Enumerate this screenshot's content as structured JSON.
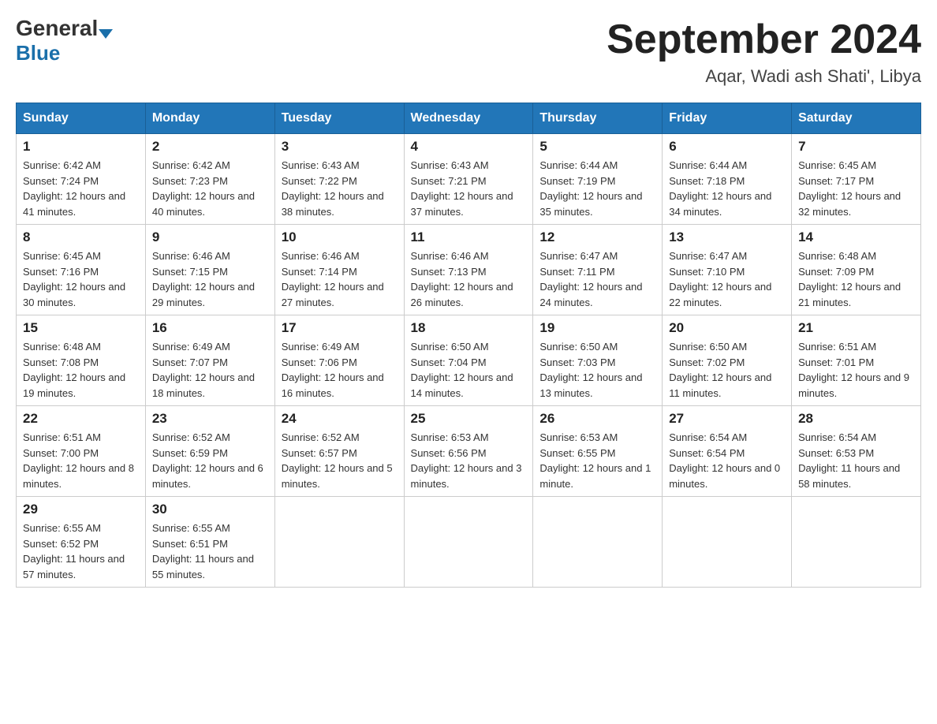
{
  "logo": {
    "general": "General",
    "blue": "Blue"
  },
  "title": {
    "month_year": "September 2024",
    "location": "Aqar, Wadi ash Shati', Libya"
  },
  "days_of_week": [
    "Sunday",
    "Monday",
    "Tuesday",
    "Wednesday",
    "Thursday",
    "Friday",
    "Saturday"
  ],
  "weeks": [
    [
      {
        "day": "1",
        "sunrise": "Sunrise: 6:42 AM",
        "sunset": "Sunset: 7:24 PM",
        "daylight": "Daylight: 12 hours and 41 minutes."
      },
      {
        "day": "2",
        "sunrise": "Sunrise: 6:42 AM",
        "sunset": "Sunset: 7:23 PM",
        "daylight": "Daylight: 12 hours and 40 minutes."
      },
      {
        "day": "3",
        "sunrise": "Sunrise: 6:43 AM",
        "sunset": "Sunset: 7:22 PM",
        "daylight": "Daylight: 12 hours and 38 minutes."
      },
      {
        "day": "4",
        "sunrise": "Sunrise: 6:43 AM",
        "sunset": "Sunset: 7:21 PM",
        "daylight": "Daylight: 12 hours and 37 minutes."
      },
      {
        "day": "5",
        "sunrise": "Sunrise: 6:44 AM",
        "sunset": "Sunset: 7:19 PM",
        "daylight": "Daylight: 12 hours and 35 minutes."
      },
      {
        "day": "6",
        "sunrise": "Sunrise: 6:44 AM",
        "sunset": "Sunset: 7:18 PM",
        "daylight": "Daylight: 12 hours and 34 minutes."
      },
      {
        "day": "7",
        "sunrise": "Sunrise: 6:45 AM",
        "sunset": "Sunset: 7:17 PM",
        "daylight": "Daylight: 12 hours and 32 minutes."
      }
    ],
    [
      {
        "day": "8",
        "sunrise": "Sunrise: 6:45 AM",
        "sunset": "Sunset: 7:16 PM",
        "daylight": "Daylight: 12 hours and 30 minutes."
      },
      {
        "day": "9",
        "sunrise": "Sunrise: 6:46 AM",
        "sunset": "Sunset: 7:15 PM",
        "daylight": "Daylight: 12 hours and 29 minutes."
      },
      {
        "day": "10",
        "sunrise": "Sunrise: 6:46 AM",
        "sunset": "Sunset: 7:14 PM",
        "daylight": "Daylight: 12 hours and 27 minutes."
      },
      {
        "day": "11",
        "sunrise": "Sunrise: 6:46 AM",
        "sunset": "Sunset: 7:13 PM",
        "daylight": "Daylight: 12 hours and 26 minutes."
      },
      {
        "day": "12",
        "sunrise": "Sunrise: 6:47 AM",
        "sunset": "Sunset: 7:11 PM",
        "daylight": "Daylight: 12 hours and 24 minutes."
      },
      {
        "day": "13",
        "sunrise": "Sunrise: 6:47 AM",
        "sunset": "Sunset: 7:10 PM",
        "daylight": "Daylight: 12 hours and 22 minutes."
      },
      {
        "day": "14",
        "sunrise": "Sunrise: 6:48 AM",
        "sunset": "Sunset: 7:09 PM",
        "daylight": "Daylight: 12 hours and 21 minutes."
      }
    ],
    [
      {
        "day": "15",
        "sunrise": "Sunrise: 6:48 AM",
        "sunset": "Sunset: 7:08 PM",
        "daylight": "Daylight: 12 hours and 19 minutes."
      },
      {
        "day": "16",
        "sunrise": "Sunrise: 6:49 AM",
        "sunset": "Sunset: 7:07 PM",
        "daylight": "Daylight: 12 hours and 18 minutes."
      },
      {
        "day": "17",
        "sunrise": "Sunrise: 6:49 AM",
        "sunset": "Sunset: 7:06 PM",
        "daylight": "Daylight: 12 hours and 16 minutes."
      },
      {
        "day": "18",
        "sunrise": "Sunrise: 6:50 AM",
        "sunset": "Sunset: 7:04 PM",
        "daylight": "Daylight: 12 hours and 14 minutes."
      },
      {
        "day": "19",
        "sunrise": "Sunrise: 6:50 AM",
        "sunset": "Sunset: 7:03 PM",
        "daylight": "Daylight: 12 hours and 13 minutes."
      },
      {
        "day": "20",
        "sunrise": "Sunrise: 6:50 AM",
        "sunset": "Sunset: 7:02 PM",
        "daylight": "Daylight: 12 hours and 11 minutes."
      },
      {
        "day": "21",
        "sunrise": "Sunrise: 6:51 AM",
        "sunset": "Sunset: 7:01 PM",
        "daylight": "Daylight: 12 hours and 9 minutes."
      }
    ],
    [
      {
        "day": "22",
        "sunrise": "Sunrise: 6:51 AM",
        "sunset": "Sunset: 7:00 PM",
        "daylight": "Daylight: 12 hours and 8 minutes."
      },
      {
        "day": "23",
        "sunrise": "Sunrise: 6:52 AM",
        "sunset": "Sunset: 6:59 PM",
        "daylight": "Daylight: 12 hours and 6 minutes."
      },
      {
        "day": "24",
        "sunrise": "Sunrise: 6:52 AM",
        "sunset": "Sunset: 6:57 PM",
        "daylight": "Daylight: 12 hours and 5 minutes."
      },
      {
        "day": "25",
        "sunrise": "Sunrise: 6:53 AM",
        "sunset": "Sunset: 6:56 PM",
        "daylight": "Daylight: 12 hours and 3 minutes."
      },
      {
        "day": "26",
        "sunrise": "Sunrise: 6:53 AM",
        "sunset": "Sunset: 6:55 PM",
        "daylight": "Daylight: 12 hours and 1 minute."
      },
      {
        "day": "27",
        "sunrise": "Sunrise: 6:54 AM",
        "sunset": "Sunset: 6:54 PM",
        "daylight": "Daylight: 12 hours and 0 minutes."
      },
      {
        "day": "28",
        "sunrise": "Sunrise: 6:54 AM",
        "sunset": "Sunset: 6:53 PM",
        "daylight": "Daylight: 11 hours and 58 minutes."
      }
    ],
    [
      {
        "day": "29",
        "sunrise": "Sunrise: 6:55 AM",
        "sunset": "Sunset: 6:52 PM",
        "daylight": "Daylight: 11 hours and 57 minutes."
      },
      {
        "day": "30",
        "sunrise": "Sunrise: 6:55 AM",
        "sunset": "Sunset: 6:51 PM",
        "daylight": "Daylight: 11 hours and 55 minutes."
      },
      null,
      null,
      null,
      null,
      null
    ]
  ]
}
